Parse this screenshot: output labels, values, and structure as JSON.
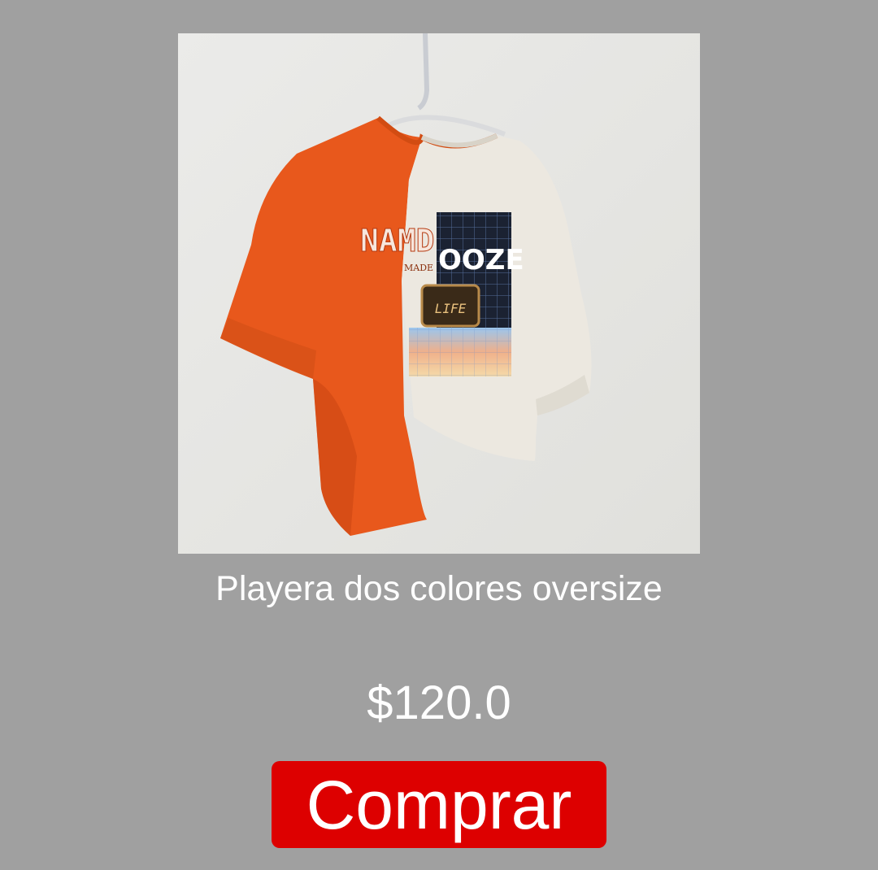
{
  "product": {
    "image_alt": "two-tone-oversize-tshirt-photo",
    "title": "Playera dos colores oversize",
    "price": "$120.0",
    "buy_label": "Comprar",
    "print_text_left": "NAMD",
    "print_text_right": "OOZE",
    "print_small_text": "MADE",
    "print_screen_text": "LIFE"
  },
  "colors": {
    "background": "#a0a0a0",
    "button": "#dd0000",
    "text": "#ffffff",
    "shirt_orange": "#e8581c",
    "shirt_white": "#ece8e0"
  }
}
